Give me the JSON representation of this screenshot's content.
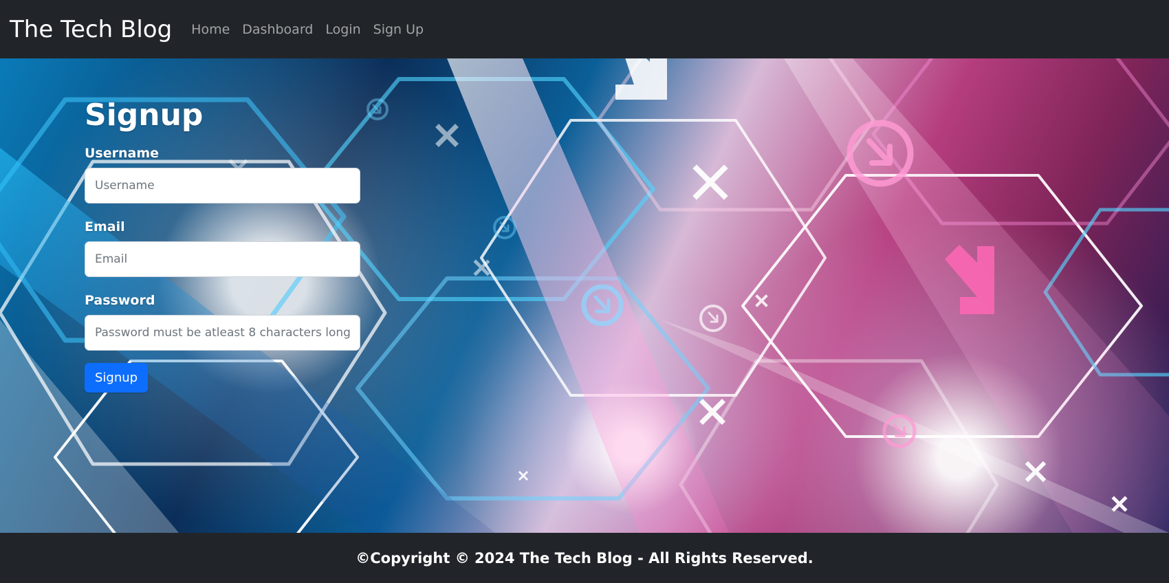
{
  "header": {
    "brand": "The Tech Blog",
    "nav": [
      {
        "label": "Home"
      },
      {
        "label": "Dashboard"
      },
      {
        "label": "Login"
      },
      {
        "label": "Sign Up"
      }
    ]
  },
  "signup": {
    "title": "Signup",
    "fields": {
      "username": {
        "label": "Username",
        "placeholder": "Username",
        "value": ""
      },
      "email": {
        "label": "Email",
        "placeholder": "Email",
        "value": ""
      },
      "password": {
        "label": "Password",
        "placeholder": "Password must be atleast 8 characters long",
        "value": ""
      }
    },
    "submit_label": "Signup"
  },
  "footer": {
    "copyright": "©Copyright © 2024 The Tech Blog - All Rights Reserved."
  },
  "theme": {
    "navbar_background": "#212529",
    "primary_button": "#0d6efd",
    "background_style": "technology hexagon pattern in blue, white, pink and purple"
  }
}
